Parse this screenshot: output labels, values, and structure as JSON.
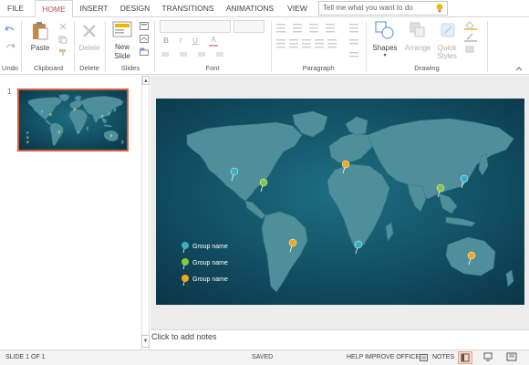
{
  "tabs": [
    {
      "label": "FILE"
    },
    {
      "label": "HOME",
      "active": true
    },
    {
      "label": "INSERT"
    },
    {
      "label": "DESIGN"
    },
    {
      "label": "TRANSITIONS"
    },
    {
      "label": "ANIMATIONS"
    },
    {
      "label": "VIEW"
    }
  ],
  "tell_me": {
    "placeholder": "Tell me what you want to do"
  },
  "ribbon": {
    "groups": {
      "undo": "Undo",
      "clipboard": "Clipboard",
      "delete": "Delete",
      "slides": "Slides",
      "font": "Font",
      "paragraph": "Paragraph",
      "drawing": "Drawing"
    },
    "buttons": {
      "paste": "Paste",
      "delete": "Delete",
      "new_slide_line1": "New",
      "new_slide_line2": "Slide",
      "shapes": "Shapes",
      "arrange": "Arrange",
      "quick_styles_line1": "Quick",
      "quick_styles_line2": "Styles"
    },
    "font_buttons": [
      "B",
      "I",
      "U",
      "A"
    ]
  },
  "thumbnails": [
    {
      "number": "1",
      "selected": true
    }
  ],
  "slide": {
    "background_color": "#0e4a5f",
    "land_color": "#4a8a97",
    "legend": [
      {
        "label": "Group name",
        "color": "#3ab0c8"
      },
      {
        "label": "Group name",
        "color": "#8cc63f"
      },
      {
        "label": "Group name",
        "color": "#f4a81d"
      }
    ],
    "pin_colors": [
      "#3ab0c8",
      "#8cc63f",
      "#f4a81d"
    ]
  },
  "notes": {
    "placeholder": "Click to add notes"
  },
  "status": {
    "slide_counter": "SLIDE 1 OF 1",
    "saved": "SAVED",
    "help": "HELP IMPROVE OFFICE",
    "notes": "NOTES"
  },
  "colors": {
    "accent": "#c0504d"
  }
}
